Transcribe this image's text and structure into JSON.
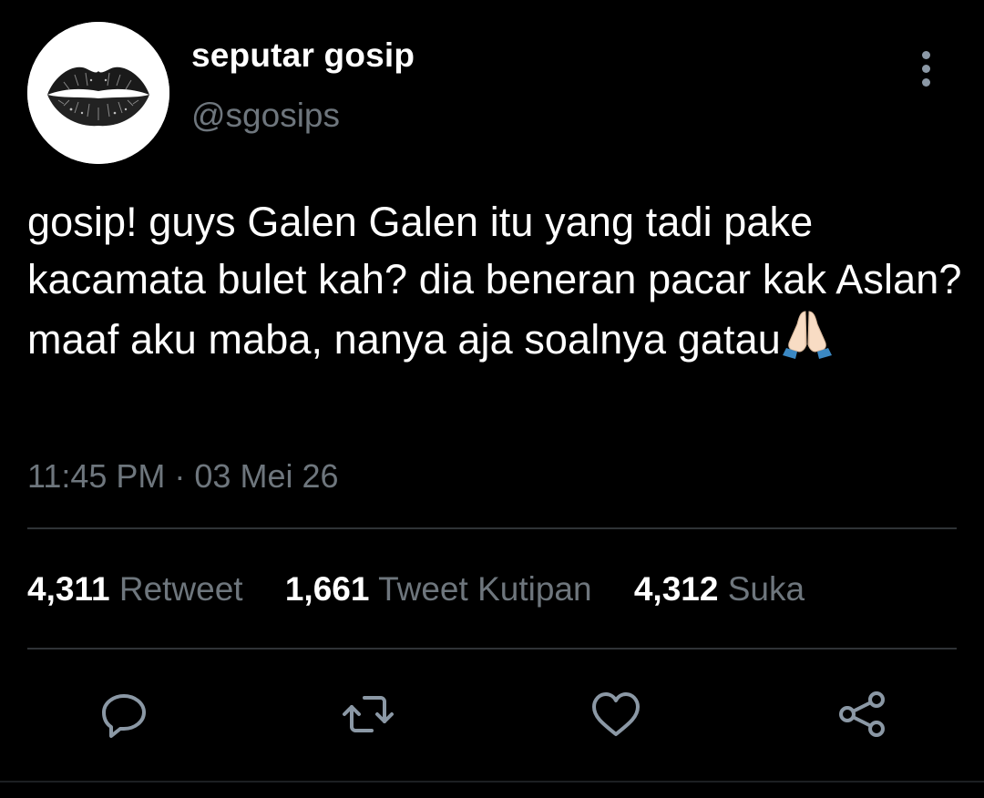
{
  "user": {
    "display_name": "seputar gosip",
    "handle": "@sgosips",
    "avatar_icon": "lips-kiss-print-icon"
  },
  "tweet": {
    "text": "gosip! guys Galen Galen itu yang tadi pake kacamata bulet kah? dia beneran pacar kak Aslan? maaf aku maba, nanya aja soalnya gatau",
    "emoji": "folded-hands-emoji",
    "timestamp": "11:45 PM · 03 Mei 26"
  },
  "stats": {
    "retweets": {
      "count": "4,311",
      "label": "Retweet"
    },
    "quotes": {
      "count": "1,661",
      "label": "Tweet Kutipan"
    },
    "likes": {
      "count": "4,312",
      "label": "Suka"
    }
  },
  "colors": {
    "background": "#000000",
    "primary_text": "#ffffff",
    "secondary_text": "#6e767d",
    "icon": "#8b98a5",
    "divider": "#2f3336"
  }
}
